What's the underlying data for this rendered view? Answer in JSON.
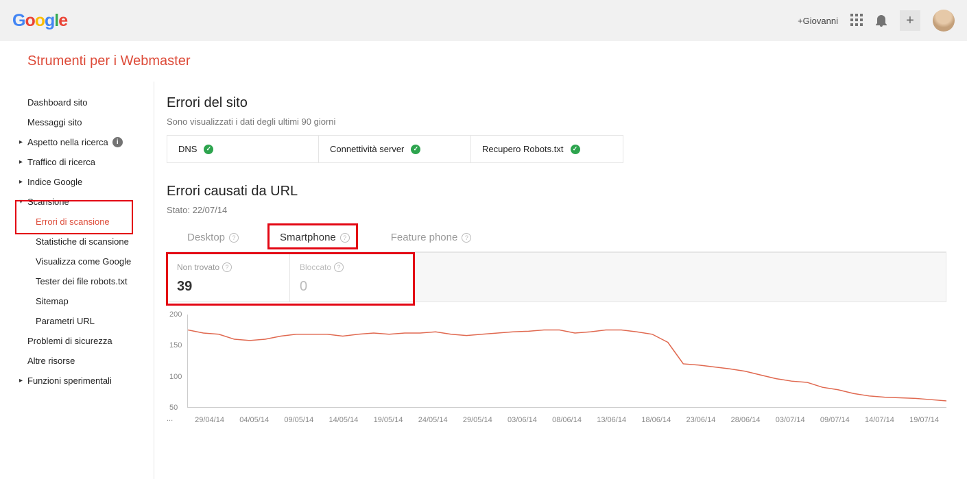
{
  "header": {
    "user_link": "+Giovanni",
    "logo": "Google"
  },
  "page_title": "Strumenti per i Webmaster",
  "sidebar": {
    "dashboard": "Dashboard sito",
    "messages": "Messaggi sito",
    "aspect": "Aspetto nella ricerca",
    "traffic": "Traffico di ricerca",
    "index": "Indice Google",
    "crawl": "Scansione",
    "crawl_errors": "Errori di scansione",
    "crawl_stats": "Statistiche di scansione",
    "fetch": "Visualizza come Google",
    "robots": "Tester dei file robots.txt",
    "sitemap": "Sitemap",
    "params": "Parametri URL",
    "security": "Problemi di sicurezza",
    "other": "Altre risorse",
    "labs": "Funzioni sperimentali"
  },
  "site_errors": {
    "title": "Errori del sito",
    "note": "Sono visualizzati i dati degli ultimi 90 giorni",
    "dns": "DNS",
    "conn": "Connettività server",
    "robots": "Recupero Robots.txt"
  },
  "url_errors": {
    "title": "Errori causati da URL",
    "state_label": "Stato: 22/07/14",
    "tabs": {
      "desktop": "Desktop",
      "smartphone": "Smartphone",
      "feature": "Feature phone"
    },
    "cards": {
      "notfound_label": "Non trovato",
      "notfound_value": "39",
      "blocked_label": "Bloccato",
      "blocked_value": "0"
    }
  },
  "chart_data": {
    "type": "line",
    "title": "",
    "xlabel": "",
    "ylabel": "",
    "ylim": [
      50,
      200
    ],
    "yticks": [
      50,
      100,
      150,
      200
    ],
    "categories": [
      "29/04/14",
      "04/05/14",
      "09/05/14",
      "14/05/14",
      "19/05/14",
      "24/05/14",
      "29/05/14",
      "03/06/14",
      "08/06/14",
      "13/06/14",
      "18/06/14",
      "23/06/14",
      "28/06/14",
      "03/07/14",
      "09/07/14",
      "14/07/14",
      "19/07/14"
    ],
    "series": [
      {
        "name": "Non trovato",
        "color": "#e06950",
        "values": [
          175,
          170,
          168,
          160,
          158,
          160,
          165,
          168,
          168,
          168,
          165,
          168,
          170,
          168,
          170,
          170,
          172,
          168,
          166,
          168,
          170,
          172,
          173,
          175,
          175,
          170,
          172,
          175,
          175,
          172,
          168,
          155,
          120,
          118,
          115,
          112,
          108,
          102,
          96,
          92,
          90,
          82,
          78,
          72,
          68,
          66,
          65,
          64,
          62,
          60
        ]
      }
    ]
  },
  "ellipsis": "..."
}
